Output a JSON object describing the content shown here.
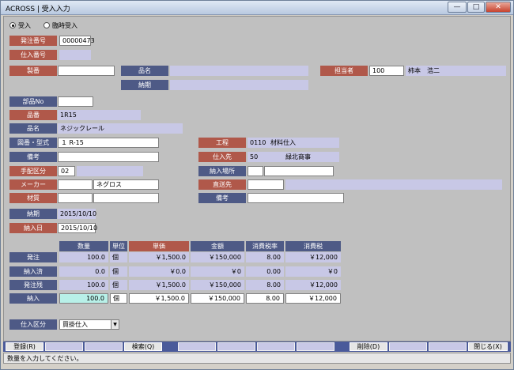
{
  "window": {
    "title": "ACROSS | 受入入力",
    "min": "—",
    "max": "□",
    "close": "✕"
  },
  "mode": {
    "options": [
      "受入",
      "臨時受入"
    ],
    "selected": 0
  },
  "header": {
    "order_no_label": "発注番号",
    "order_no": "00000473",
    "purchase_no_label": "仕入番号",
    "purchase_no": "",
    "seiban_label": "製番",
    "seiban": "",
    "hinmei_label": "品名",
    "hinmei": "",
    "nouki_label": "納期",
    "nouki": "",
    "tantou_label": "担当者",
    "tantou_code": "100",
    "tantou_name": "柿本　浩二"
  },
  "detail": {
    "buhin_label": "部品No",
    "buhin": "",
    "hinban_label": "品番",
    "hinban": "1R15",
    "hinmei_label": "品名",
    "hinmei": "ネジックレール",
    "zuban_label": "図番・型式",
    "zuban": "１ R-15",
    "bikou_label": "備考",
    "bikou": "",
    "tehai_label": "手配区分",
    "tehai": "02",
    "maker_label": "メーカー",
    "maker_code": "",
    "maker_name": "ネグロス",
    "zaishitsu_label": "材質",
    "zaishitsu1": "",
    "zaishitsu2": "",
    "koutei_label": "工程",
    "koutei_code": "0110",
    "koutei_name": "材料仕入",
    "shiire_label": "仕入先",
    "shiire_code": "50",
    "shiire_name": "緑北商事",
    "basho_label": "納入場所",
    "basho_code": "",
    "basho_name": "",
    "chokusou_label": "直送先",
    "chokusou_code": "",
    "chokusou_name": "",
    "bikou2_label": "備考",
    "bikou2": "",
    "nouki_label": "納期",
    "nouki": "2015/10/10",
    "nounyu_label": "納入日",
    "nounyu": "2015/10/10"
  },
  "grid": {
    "headers": [
      "数量",
      "単位",
      "単価",
      "金額",
      "消費税率",
      "消費税"
    ],
    "rows": [
      {
        "label": "発注",
        "qty": "100.0",
        "unit": "個",
        "price": "￥1,500.0",
        "amount": "￥150,000",
        "rate": "8.00",
        "tax": "￥12,000"
      },
      {
        "label": "納入済",
        "qty": "0.0",
        "unit": "個",
        "price": "￥0.0",
        "amount": "￥0",
        "rate": "0.00",
        "tax": "￥0"
      },
      {
        "label": "発注残",
        "qty": "100.0",
        "unit": "個",
        "price": "￥1,500.0",
        "amount": "￥150,000",
        "rate": "8.00",
        "tax": "￥12,000"
      },
      {
        "label": "納入",
        "qty": "100.0",
        "unit": "個",
        "price": "￥1,500.0",
        "amount": "￥150,000",
        "rate": "8.00",
        "tax": "￥12,000"
      }
    ]
  },
  "shiire_kubun": {
    "label": "仕入区分",
    "value": "買掛仕入"
  },
  "fkeys": [
    "登録(R)",
    "",
    "",
    "検索(Q)",
    "",
    "",
    "",
    "",
    "削除(D)",
    "",
    "",
    "閉じる(X)"
  ],
  "status": "数量を入力してください。",
  "colors": {
    "label_red": "#b0584a",
    "label_blue": "#4e5a86",
    "readonly": "#c8c8e6",
    "focus": "#b8f0e8"
  }
}
